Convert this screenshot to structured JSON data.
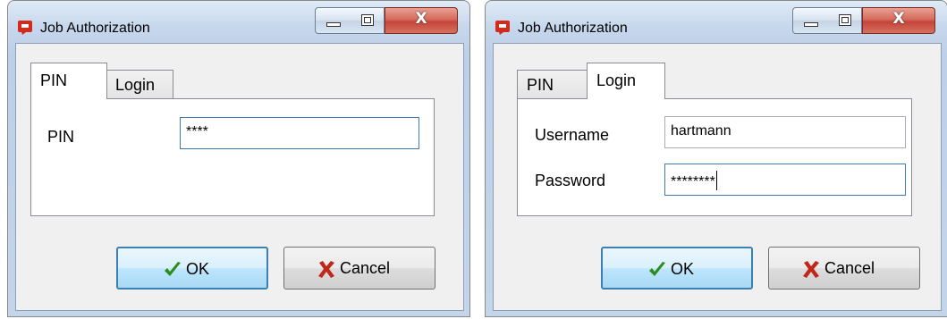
{
  "dialogs": [
    {
      "title": "Job Authorization",
      "tabs": [
        "PIN",
        "Login"
      ],
      "active_tab": "PIN",
      "fields": [
        {
          "label": "PIN",
          "value": "****"
        }
      ],
      "buttons": {
        "ok": "OK",
        "cancel": "Cancel"
      }
    },
    {
      "title": "Job Authorization",
      "tabs": [
        "PIN",
        "Login"
      ],
      "active_tab": "Login",
      "fields": [
        {
          "label": "Username",
          "value": "hartmann"
        },
        {
          "label": "Password",
          "value": "********"
        }
      ],
      "buttons": {
        "ok": "OK",
        "cancel": "Cancel"
      }
    }
  ],
  "colors": {
    "ok_icon": "#2e8b1e",
    "cancel_icon": "#c0271a",
    "app_icon": "#d42a1c"
  },
  "icons": [
    "app-icon",
    "minimize-icon",
    "maximize-icon",
    "close-icon",
    "checkmark-icon",
    "x-cancel-icon"
  ]
}
